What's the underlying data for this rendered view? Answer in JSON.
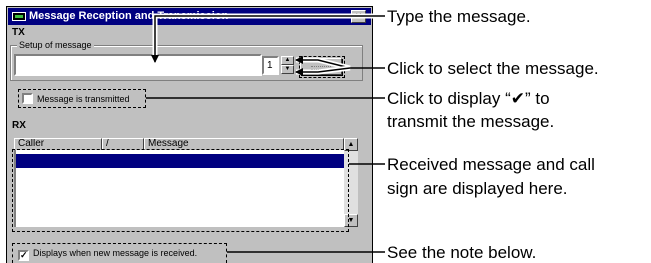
{
  "window": {
    "title": "Message Reception and Transmission",
    "close_label": "×"
  },
  "tx": {
    "label": "TX",
    "group_label": "Setup of message",
    "message_value": "",
    "message_number": "1",
    "spin_up": "▲",
    "spin_down": "▼",
    "transmitted_checkbox_label": "Message is transmitted"
  },
  "rx": {
    "label": "RX",
    "columns": [
      "Caller",
      "/",
      "Message"
    ],
    "scroll_up": "▲",
    "scroll_down": "▼",
    "new_message_checkbox_label": "Displays when new message is received.",
    "new_message_checked_mark": "✓"
  },
  "callouts": {
    "type_message": "Type the message.",
    "select_message": "Click to select the message.",
    "display_check_line1": "Click to display “✔” to",
    "display_check_line2": "transmit the message.",
    "received_line1": "Received message and call",
    "received_line2": "sign are displayed here.",
    "see_note": "See the note below."
  }
}
